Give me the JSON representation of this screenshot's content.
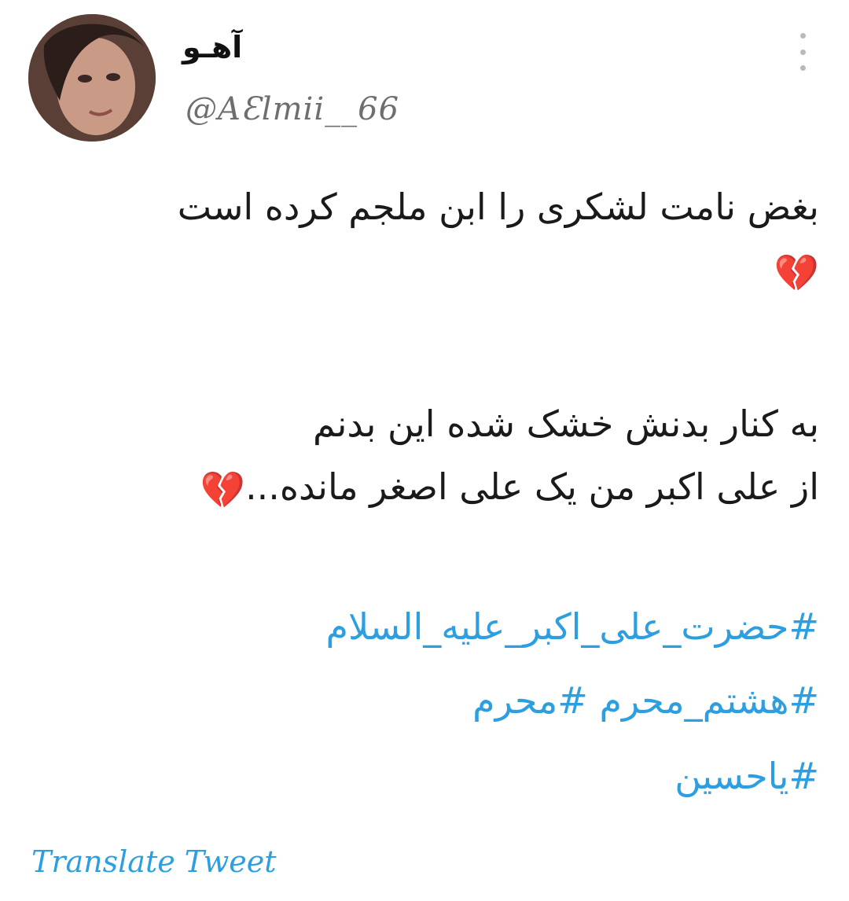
{
  "author": {
    "display_name": "آهـو",
    "handle": "@AƐlmii__66"
  },
  "tweet": {
    "line1": "بغض نامت لشکری را ابن ملجم کرده است",
    "line2_emoji": "💔",
    "line3": "به کنار بدنش خشک شده این بدنم",
    "line4": "از علی اکبر من یک علی اصغر مانده...",
    "line4_emoji": "💔",
    "hashtags": [
      "#حضرت_علی_اکبر_علیه_السلام",
      "#هشتم_محرم #محرم",
      "#یاحسین"
    ]
  },
  "translate_label": "Translate Tweet",
  "colors": {
    "link": "#2d9fe0",
    "text": "#1a1a1a",
    "secondary": "#6e6e6e"
  }
}
